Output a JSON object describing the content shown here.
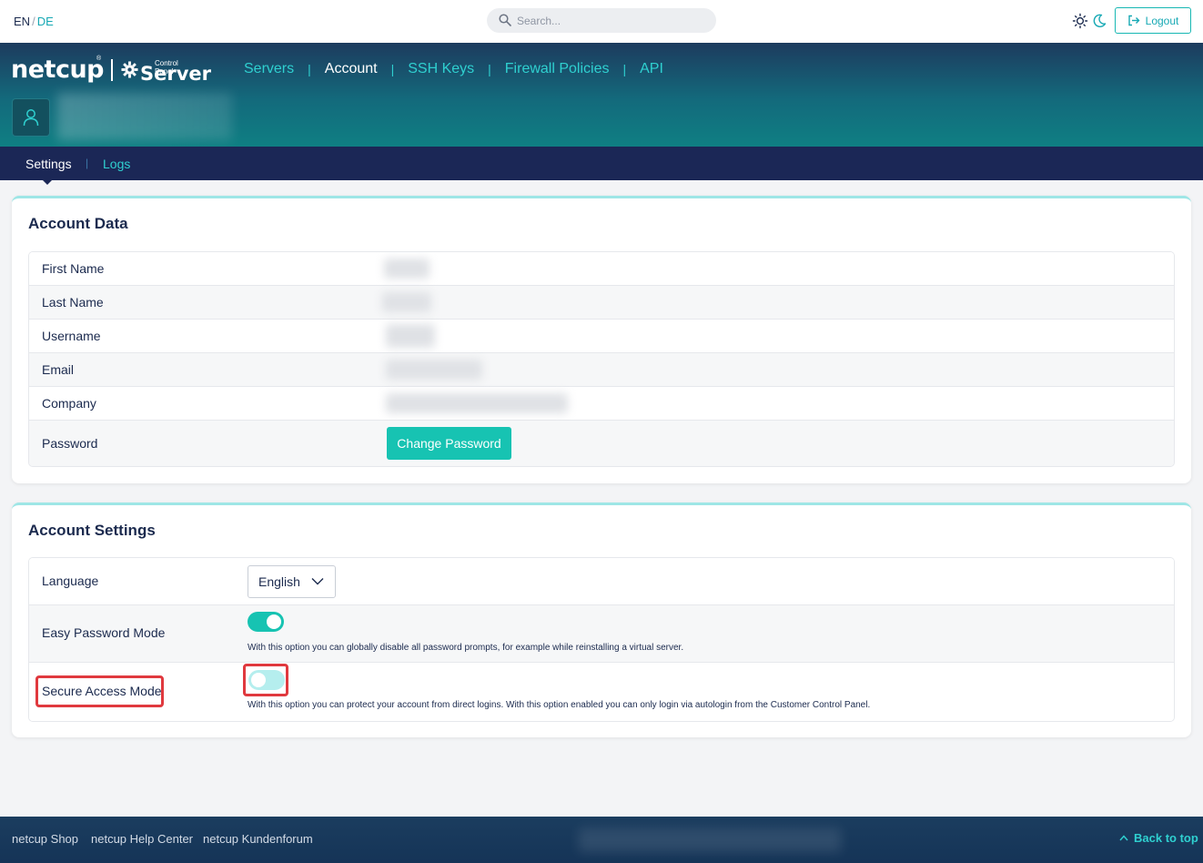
{
  "topbar": {
    "lang_en": "EN",
    "lang_sep": "/",
    "lang_de": "DE",
    "search_placeholder": "Search...",
    "logout_label": "Logout"
  },
  "brand": {
    "logo_text": "netcup",
    "registered": "®",
    "control_panel": "Control Panel",
    "product": "Server"
  },
  "nav": {
    "items": [
      {
        "label": "Servers"
      },
      {
        "label": "Account"
      },
      {
        "label": "SSH Keys"
      },
      {
        "label": "Firewall Policies"
      },
      {
        "label": "API"
      }
    ],
    "divider": "|",
    "active_color": "#ffffff",
    "link_color": "#2fd0d0"
  },
  "subnav": {
    "settings": "Settings",
    "divider": "|",
    "logs": "Logs"
  },
  "account_data": {
    "title": "Account Data",
    "rows": [
      {
        "label": "First Name"
      },
      {
        "label": "Last Name"
      },
      {
        "label": "Username"
      },
      {
        "label": "Email"
      },
      {
        "label": "Company"
      },
      {
        "label": "Password"
      }
    ],
    "change_password": "Change Password"
  },
  "account_settings": {
    "title": "Account Settings",
    "language_label": "Language",
    "language_value": "English",
    "easy_password_label": "Easy Password Mode",
    "easy_password_enabled": true,
    "easy_password_help": "With this option you can globally disable all password prompts, for example while reinstalling a virtual server.",
    "secure_access_label": "Secure Access Mode",
    "secure_access_enabled": false,
    "secure_access_help": "With this option you can protect your account from direct logins. With this option enabled you can only login via autologin from the Customer Control Panel."
  },
  "footer": {
    "links": [
      {
        "label": "netcup Shop"
      },
      {
        "label": "netcup Help Center"
      },
      {
        "label": "netcup Kundenforum"
      }
    ],
    "back_to_top": "Back to top"
  },
  "colors": {
    "accent": "#17c3b2",
    "navy": "#1b2756",
    "highlight": "#e0393e"
  }
}
